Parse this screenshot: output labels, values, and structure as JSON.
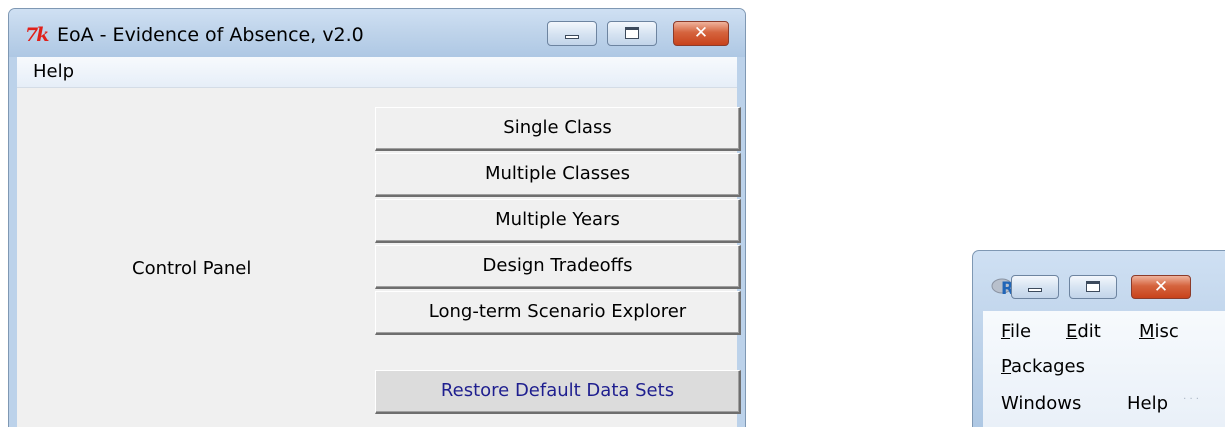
{
  "eoa_window": {
    "title": "EoA - Evidence of Absence, v2.0",
    "app_icon_text": "7k",
    "menu": {
      "help": "Help"
    },
    "panel_label": "Control Panel",
    "buttons": {
      "single_class": "Single Class",
      "multiple_classes": "Multiple Classes",
      "multiple_years": "Multiple Years",
      "design_tradeoffs": "Design Tradeoffs",
      "long_term": "Long-term Scenario Explorer",
      "restore": "Restore Default Data Sets"
    }
  },
  "r_window": {
    "menu": {
      "file_rest": "ile",
      "file_key": "F",
      "edit_key": "E",
      "edit_rest": "dit",
      "misc_key": "M",
      "misc_rest": "isc",
      "packages_key": "P",
      "packages_rest": "ackages",
      "windows": "Windows",
      "help": "Help"
    }
  },
  "icons": {
    "close_glyph": "✕",
    "resize_grip": "· ·\n ·"
  }
}
